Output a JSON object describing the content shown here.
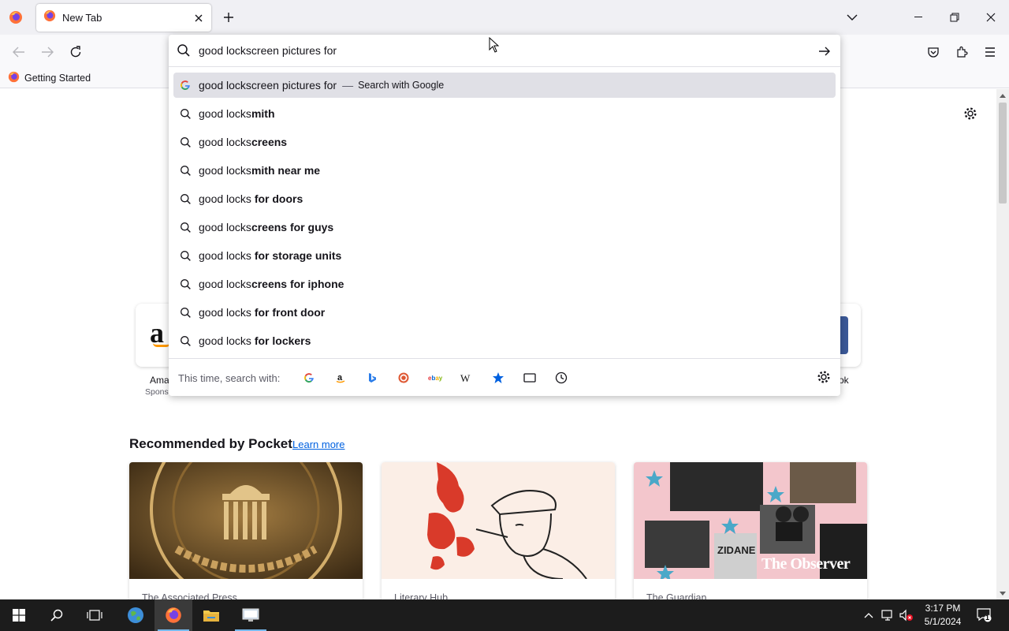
{
  "browser": {
    "tab_title": "New Tab",
    "bookmark_label": "Getting Started"
  },
  "urlbar": {
    "value": "good lockscreen pictures for",
    "suggestions": [
      {
        "prefix": "good lockscreen pictures for",
        "bold": "",
        "action": "Search with Google",
        "icon": "google-icon",
        "selected": true
      },
      {
        "prefix": "good locks",
        "bold": "mith",
        "icon": "search-icon"
      },
      {
        "prefix": "good locks",
        "bold": "creens",
        "icon": "search-icon"
      },
      {
        "prefix": "good locks",
        "bold": "mith near me",
        "icon": "search-icon"
      },
      {
        "prefix": "good locks ",
        "bold": "for doors",
        "icon": "search-icon"
      },
      {
        "prefix": "good locks",
        "bold": "creens for guys",
        "icon": "search-icon"
      },
      {
        "prefix": "good locks ",
        "bold": "for storage units",
        "icon": "search-icon"
      },
      {
        "prefix": "good locks",
        "bold": "creens for iphone",
        "icon": "search-icon"
      },
      {
        "prefix": "good locks ",
        "bold": "for front door",
        "icon": "search-icon"
      },
      {
        "prefix": "good locks ",
        "bold": "for lockers",
        "icon": "search-icon"
      }
    ],
    "oneoff_label": "This time, search with:",
    "oneoff_engines": [
      "google-icon",
      "amazon-icon",
      "bing-icon",
      "duckduckgo-icon",
      "ebay-icon",
      "wikipedia-icon",
      "bookmarks-icon",
      "tabs-icon",
      "history-icon"
    ]
  },
  "shortcuts": {
    "amazon_label": "Ama",
    "amazon_sub": "Spons",
    "facebook_label": "ok"
  },
  "pocket": {
    "title": "Recommended by Pocket",
    "learn_more": "Learn more",
    "cards": [
      {
        "source": "The Associated Press",
        "image": "federal-reserve-seal"
      },
      {
        "source": "Literary Hub",
        "image": "sketch-man-smoking"
      },
      {
        "source": "The Guardian",
        "image": "observer-collage",
        "image_text": "The Observer",
        "jersey_text": "ZIDANE"
      }
    ]
  },
  "taskbar": {
    "time": "3:17 PM",
    "date": "5/1/2024",
    "notification_count": "1"
  },
  "colors": {
    "accent": "#0061e0",
    "tabbar": "#f0f0f4",
    "selected_row": "#e0e0e6",
    "taskbar": "#1c1c1c"
  }
}
